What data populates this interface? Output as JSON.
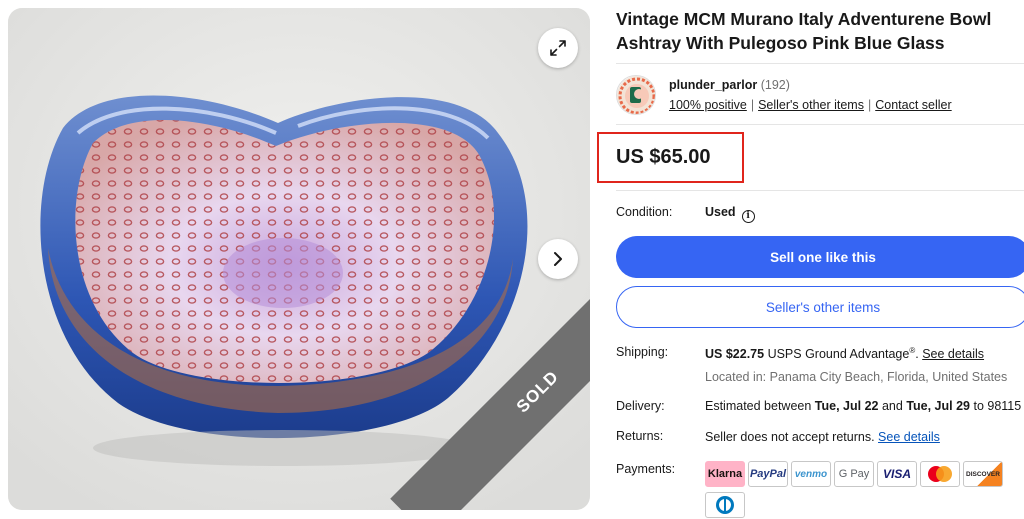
{
  "gallery": {
    "sold_label": "SOLD",
    "icons": [
      "expand-icon",
      "chevron-right-icon"
    ]
  },
  "item": {
    "title": "Vintage MCM Murano Italy Adventurene Bowl Ashtray With Pulegoso Pink Blue Glass",
    "price": "US $65.00"
  },
  "seller": {
    "name": "plunder_parlor",
    "feedback_count": "(192)",
    "positive": "100% positive",
    "other_items_link": "Seller's other items",
    "contact_link": "Contact seller"
  },
  "condition": {
    "label": "Condition:",
    "value": "Used"
  },
  "buttons": {
    "primary": "Sell one like this",
    "secondary": "Seller's other items"
  },
  "shipping": {
    "label": "Shipping:",
    "cost": "US $22.75",
    "service": "USPS Ground Advantage",
    "registered": "®",
    "details_link": "See details",
    "location": "Located in: Panama City Beach, Florida, United States"
  },
  "delivery": {
    "label": "Delivery:",
    "prefix": "Estimated between",
    "start": "Tue, Jul 22",
    "and": "and",
    "end": "Tue, Jul 29",
    "to": "to 98115"
  },
  "returns": {
    "label": "Returns:",
    "text": "Seller does not accept returns.",
    "details_link": "See details"
  },
  "payments": {
    "label": "Payments:",
    "methods": [
      "Klarna",
      "PayPal",
      "venmo",
      "G Pay",
      "VISA",
      "Mastercard",
      "DISCOVER",
      "Diners Club"
    ]
  },
  "colors": {
    "accent_blue": "#3665f3",
    "highlight_red": "#e0251c",
    "link_blue": "#0654ba"
  }
}
